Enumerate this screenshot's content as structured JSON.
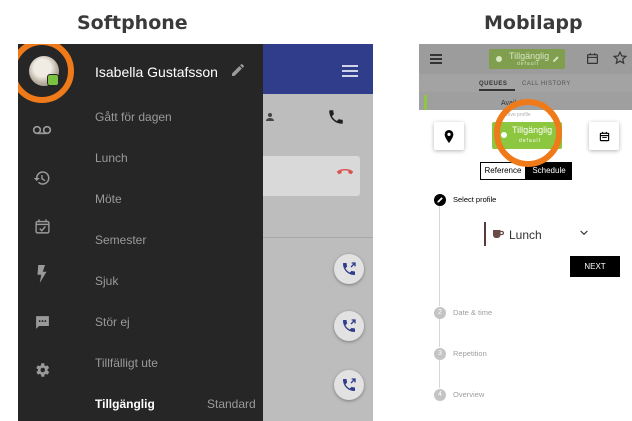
{
  "headings": {
    "softphone": "Softphone",
    "mobile": "Mobilapp"
  },
  "softphone": {
    "user_name": "Isabella Gustafsson",
    "status_menu": [
      "Gått för dagen",
      "Lunch",
      "Möte",
      "Semester",
      "Sjuk",
      "Stör ej",
      "Tillfälligt ute",
      "Tillgänglig"
    ],
    "active_status": "Tillgänglig",
    "active_status_suffix": "Standard",
    "rail_icons": [
      "voicemail-icon",
      "history-icon",
      "calendar-check-icon",
      "flash-icon",
      "chat-icon",
      "settings-icon"
    ],
    "colors": {
      "drawer_bg": "#262626",
      "topbar": "#2f3d8a",
      "available_green": "#7cc242",
      "highlight_ring": "#ef7a1a",
      "hangup_red": "#d9534f"
    }
  },
  "mobile": {
    "top_chip_label": "Tillgänglig",
    "top_chip_sub": "default",
    "tabs": [
      "QUEUES",
      "CALL HISTORY"
    ],
    "subbar_label": "Available",
    "profile_chip_label": "Tillgänglig",
    "profile_chip_sub": "default",
    "profile_chip_caption": "Active profile",
    "segments": [
      "Reference",
      "Schedule"
    ],
    "active_segment": "Schedule",
    "steps": [
      {
        "number": "",
        "label": "Select profile",
        "active": true
      },
      {
        "number": "2",
        "label": "Date & time",
        "active": false
      },
      {
        "number": "3",
        "label": "Repetition",
        "active": false
      },
      {
        "number": "4",
        "label": "Overview",
        "active": false
      }
    ],
    "selected_profile": "Lunch",
    "next_label": "NEXT",
    "colors": {
      "chip_green": "#8dc63f",
      "highlight_ring": "#ef7a1a"
    }
  }
}
